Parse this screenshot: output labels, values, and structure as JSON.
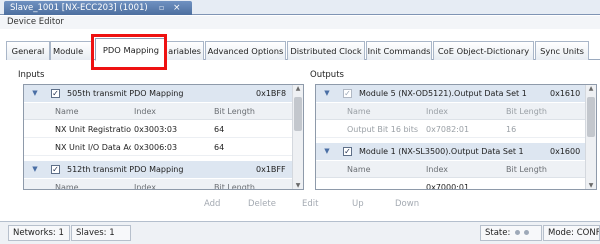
{
  "document_tab": {
    "title": "Slave_1001 [NX-ECC203] (1001)",
    "pin": "▫",
    "close": "×"
  },
  "editor_title": "Device Editor",
  "tabs": [
    {
      "label": "General"
    },
    {
      "label": "Module"
    },
    {
      "label": "PDO Mapping"
    },
    {
      "label": "ariables"
    },
    {
      "label": "Advanced Options"
    },
    {
      "label": "Distributed Clock"
    },
    {
      "label": "Init Commands"
    },
    {
      "label": "CoE Object-Dictionary"
    },
    {
      "label": "Sync Units"
    }
  ],
  "inputs": {
    "label": "Inputs",
    "group1": {
      "name": "505th transmit PDO Mapping",
      "index": "0x1BF8",
      "checked": true
    },
    "header": {
      "name": "Name",
      "index": "Index",
      "bit_length": "Bit Length"
    },
    "rows": [
      {
        "name": "NX Unit Registratio",
        "index": "0x3003:03",
        "bit_length": "64"
      },
      {
        "name": "NX Unit I/O Data Ac",
        "index": "0x3006:03",
        "bit_length": "64"
      }
    ],
    "group2": {
      "name": "512th transmit PDO Mapping",
      "index": "0x1BFF",
      "checked": true
    },
    "partial_header": {
      "name": "Name",
      "index": "Index",
      "bit_length": "Bit Length"
    }
  },
  "outputs": {
    "label": "Outputs",
    "group1": {
      "name": "Module 5 (NX-OD5121).Output Data Set 1",
      "index": "0x1610",
      "checked": true
    },
    "header1": {
      "name": "Name",
      "index": "Index",
      "bit_length": "Bit Length"
    },
    "rows": [
      {
        "name": "Output Bit 16 bits",
        "index": "0x7082:01",
        "bit_length": "16"
      }
    ],
    "group2": {
      "name": "Module 1 (NX-SL3500).Output Data Set 1",
      "index": "0x1600",
      "checked": true
    },
    "header2": {
      "name": "Name",
      "index": "Index",
      "bit_length": "Bit Length"
    },
    "partial_row": {
      "index": "0x7000:01"
    }
  },
  "actions": {
    "add": "Add",
    "delete": "Delete",
    "edit": "Edit",
    "up": "Up",
    "down": "Down"
  },
  "statusbar": {
    "networks": "Networks: 1",
    "slaves": "Slaves: 1",
    "state_label": "State:",
    "mode": "Mode: CONFIG"
  },
  "colors": {
    "highlight": "#ee1111",
    "tab_active_bg": "#4d6f9f",
    "group_row_bg": "#dde6f1"
  }
}
